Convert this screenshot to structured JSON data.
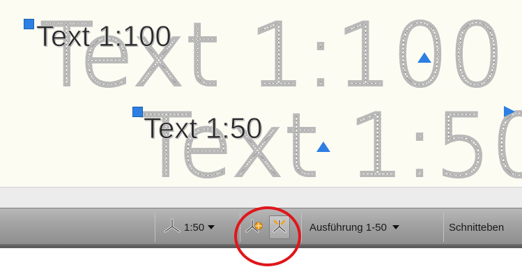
{
  "canvas": {
    "text_large_scale": "Text 1:100",
    "text_large_scale_small": "Text 1:100",
    "text_medium_scale": "Text 1:50",
    "text_medium_scale_small": "Text 1:50"
  },
  "status_bar": {
    "annotation_scale": "1:50",
    "workspace": "Ausführung 1-50",
    "section_plane": "Schnitteben"
  },
  "colors": {
    "grip": "#2d7fe3",
    "highlight": "#e0161b",
    "canvas_background": "#fdfcf3"
  },
  "icons": [
    "annotation-scale-icon",
    "auto-scale-icon",
    "annotation-visibility-icon",
    "dropdown-arrow-icon"
  ]
}
